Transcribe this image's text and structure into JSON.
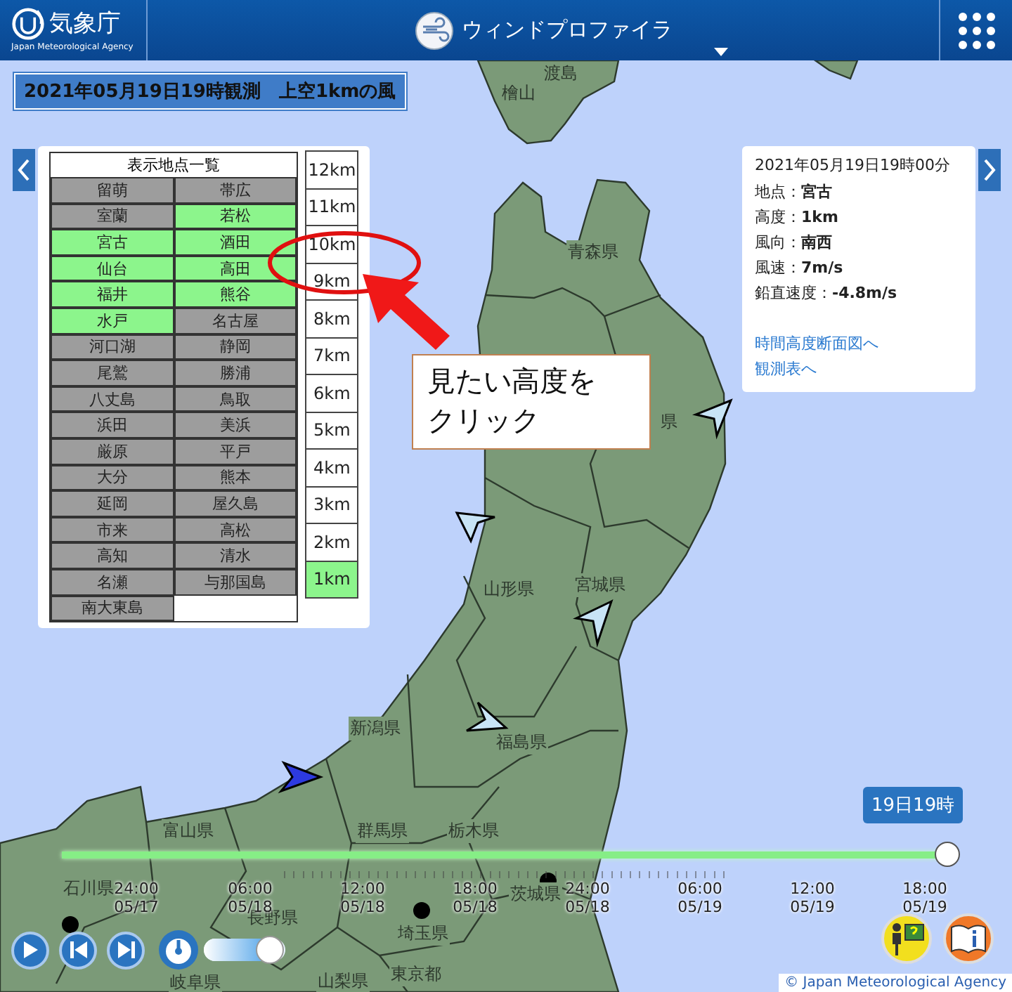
{
  "header": {
    "agency_name": "気象庁",
    "agency_name_en": "Japan Meteorological Agency",
    "title": "ウィンドプロファイラ"
  },
  "observation_banner": "2021年05月19日19時観測　上空1kmの風",
  "station_list": {
    "title": "表示地点一覧",
    "stations": [
      {
        "name": "留萌",
        "available": false
      },
      {
        "name": "帯広",
        "available": false
      },
      {
        "name": "室蘭",
        "available": false
      },
      {
        "name": "若松",
        "available": true
      },
      {
        "name": "宮古",
        "available": true
      },
      {
        "name": "酒田",
        "available": true
      },
      {
        "name": "仙台",
        "available": true
      },
      {
        "name": "高田",
        "available": true
      },
      {
        "name": "福井",
        "available": true
      },
      {
        "name": "熊谷",
        "available": true
      },
      {
        "name": "水戸",
        "available": true
      },
      {
        "name": "名古屋",
        "available": false
      },
      {
        "name": "河口湖",
        "available": false
      },
      {
        "name": "静岡",
        "available": false
      },
      {
        "name": "尾鷲",
        "available": false
      },
      {
        "name": "勝浦",
        "available": false
      },
      {
        "name": "八丈島",
        "available": false
      },
      {
        "name": "鳥取",
        "available": false
      },
      {
        "name": "浜田",
        "available": false
      },
      {
        "name": "美浜",
        "available": false
      },
      {
        "name": "厳原",
        "available": false
      },
      {
        "name": "平戸",
        "available": false
      },
      {
        "name": "大分",
        "available": false
      },
      {
        "name": "熊本",
        "available": false
      },
      {
        "name": "延岡",
        "available": false
      },
      {
        "name": "屋久島",
        "available": false
      },
      {
        "name": "市来",
        "available": false
      },
      {
        "name": "高松",
        "available": false
      },
      {
        "name": "高知",
        "available": false
      },
      {
        "name": "清水",
        "available": false
      },
      {
        "name": "名瀬",
        "available": false
      },
      {
        "name": "与那国島",
        "available": false
      },
      {
        "name": "南大東島",
        "available": false
      }
    ]
  },
  "altitudes": [
    {
      "label": "12km",
      "selected": false
    },
    {
      "label": "11km",
      "selected": false
    },
    {
      "label": "10km",
      "selected": false
    },
    {
      "label": "9km",
      "selected": false
    },
    {
      "label": "8km",
      "selected": false
    },
    {
      "label": "7km",
      "selected": false
    },
    {
      "label": "6km",
      "selected": false
    },
    {
      "label": "5km",
      "selected": false
    },
    {
      "label": "4km",
      "selected": false
    },
    {
      "label": "3km",
      "selected": false
    },
    {
      "label": "2km",
      "selected": false
    },
    {
      "label": "1km",
      "selected": true
    }
  ],
  "callout": "見たい高度をクリック",
  "info_panel": {
    "time": "2021年05月19日19時00分",
    "rows": [
      {
        "label": "地点：",
        "value": "宮古"
      },
      {
        "label": "高度：",
        "value": "1km"
      },
      {
        "label": "風向：",
        "value": "南西"
      },
      {
        "label": "風速：",
        "value": "7m/s"
      },
      {
        "label": "鉛直速度：",
        "value": "-4.8m/s"
      }
    ],
    "links": [
      "時間高度断面図へ",
      "観測表へ"
    ]
  },
  "map_labels": [
    "渡島",
    "檜山",
    "青森県",
    "県",
    "山形県",
    "宮城県",
    "新潟県",
    "福島県",
    "富山県",
    "群馬県",
    "栃木県",
    "石川県",
    "茨城県",
    "長野県",
    "埼玉県",
    "岐阜県",
    "東京都",
    "山梨県"
  ],
  "timeline": {
    "tooltip": "19日19時",
    "level": 1.0,
    "ticks": [
      {
        "time": "24:00",
        "date": "05/17"
      },
      {
        "time": "06:00",
        "date": "05/18"
      },
      {
        "time": "12:00",
        "date": "05/18"
      },
      {
        "time": "18:00",
        "date": "05/18"
      },
      {
        "time": "24:00",
        "date": "05/18"
      },
      {
        "time": "06:00",
        "date": "05/19"
      },
      {
        "time": "12:00",
        "date": "05/19"
      },
      {
        "time": "18:00",
        "date": "05/19"
      }
    ]
  },
  "speed": {
    "level": 0.85
  },
  "copyright": "© Japan Meteorological Agency"
}
